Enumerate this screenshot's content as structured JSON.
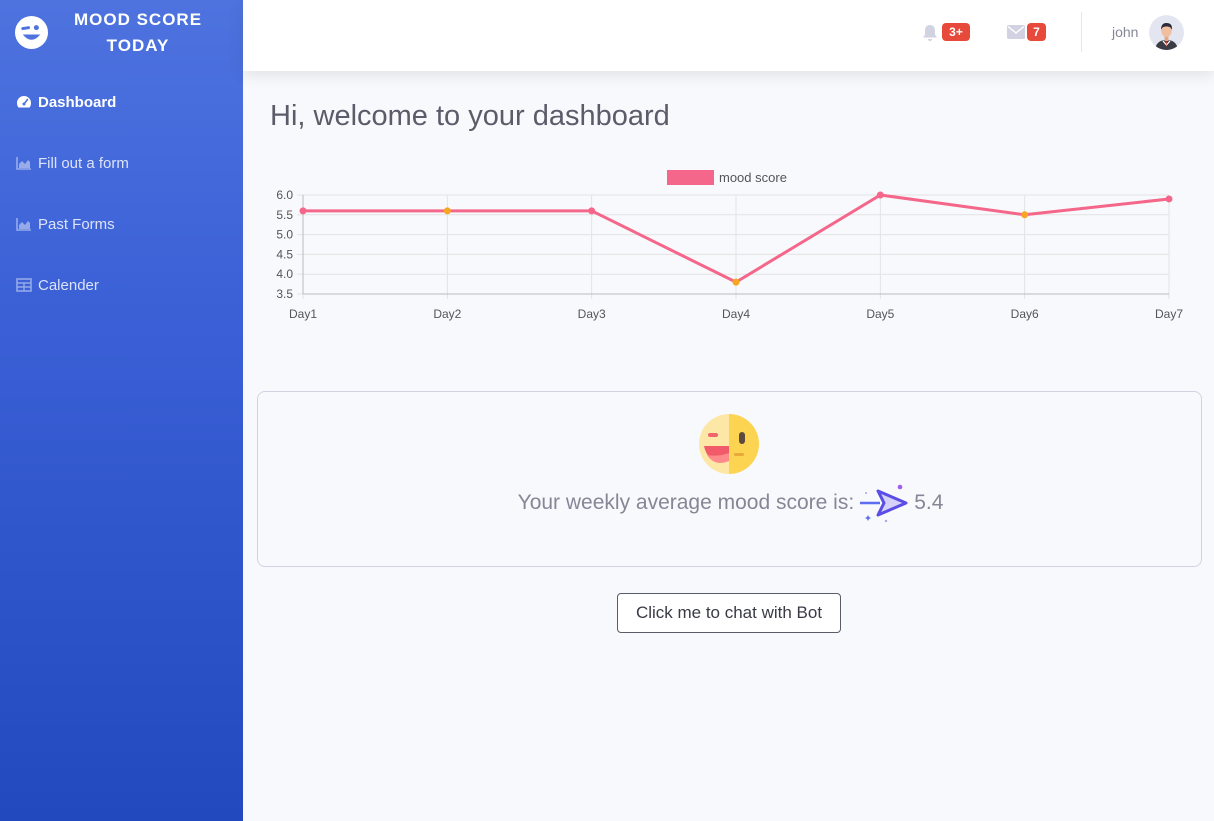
{
  "brand": {
    "title": "MOOD SCORE TODAY"
  },
  "sidebar": {
    "items": [
      {
        "label": "Dashboard",
        "icon": "tachometer-icon"
      },
      {
        "label": "Fill out a form",
        "icon": "area-chart-icon"
      },
      {
        "label": "Past Forms",
        "icon": "area-chart-icon"
      },
      {
        "label": "Calender",
        "icon": "table-icon"
      }
    ]
  },
  "topbar": {
    "alerts_badge": "3+",
    "messages_badge": "7",
    "username": "john"
  },
  "main": {
    "welcome": "Hi, welcome to your dashboard",
    "average_text": "Your weekly average mood score is:",
    "average_value": "5.4",
    "bot_button": "Click me to chat with Bot"
  },
  "colors": {
    "sidebar_top": "#4e73df",
    "sidebar_bottom": "#224abe",
    "line": "#f4678a",
    "accent_point": "#f6a623",
    "badge": "#e74a3b"
  },
  "chart_data": {
    "type": "line",
    "categories": [
      "Day1",
      "Day2",
      "Day3",
      "Day4",
      "Day5",
      "Day6",
      "Day7"
    ],
    "series": [
      {
        "name": "mood score",
        "values": [
          5.6,
          5.6,
          5.6,
          3.8,
          6.0,
          5.5,
          5.9
        ]
      }
    ],
    "yticks": [
      "6.0",
      "5.5",
      "5.0",
      "4.5",
      "4.0",
      "3.5"
    ],
    "ylim": [
      3.5,
      6.0
    ],
    "grid": true,
    "legend": "top-center",
    "point_colors": [
      "#f4678a",
      "#f6a623",
      "#f4678a",
      "#f6a623",
      "#f4678a",
      "#f6a623",
      "#f4678a"
    ]
  }
}
